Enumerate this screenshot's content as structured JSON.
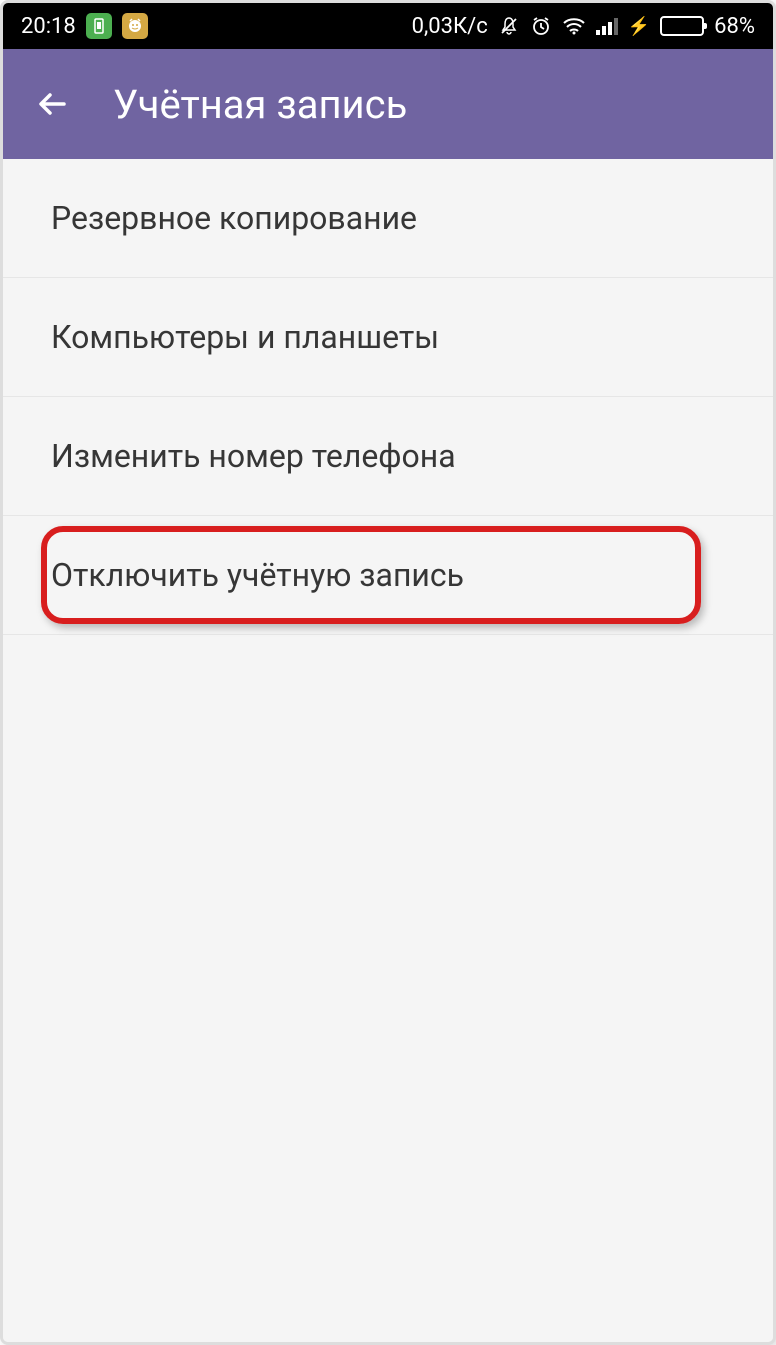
{
  "status_bar": {
    "time": "20:18",
    "data_rate": "0,03К/с",
    "battery_percent": "68%"
  },
  "header": {
    "title": "Учётная запись"
  },
  "menu_items": [
    {
      "label": "Резервное копирование",
      "highlighted": false
    },
    {
      "label": "Компьютеры и планшеты",
      "highlighted": false
    },
    {
      "label": "Изменить номер телефона",
      "highlighted": false
    },
    {
      "label": "Отключить учётную запись",
      "highlighted": true
    }
  ]
}
